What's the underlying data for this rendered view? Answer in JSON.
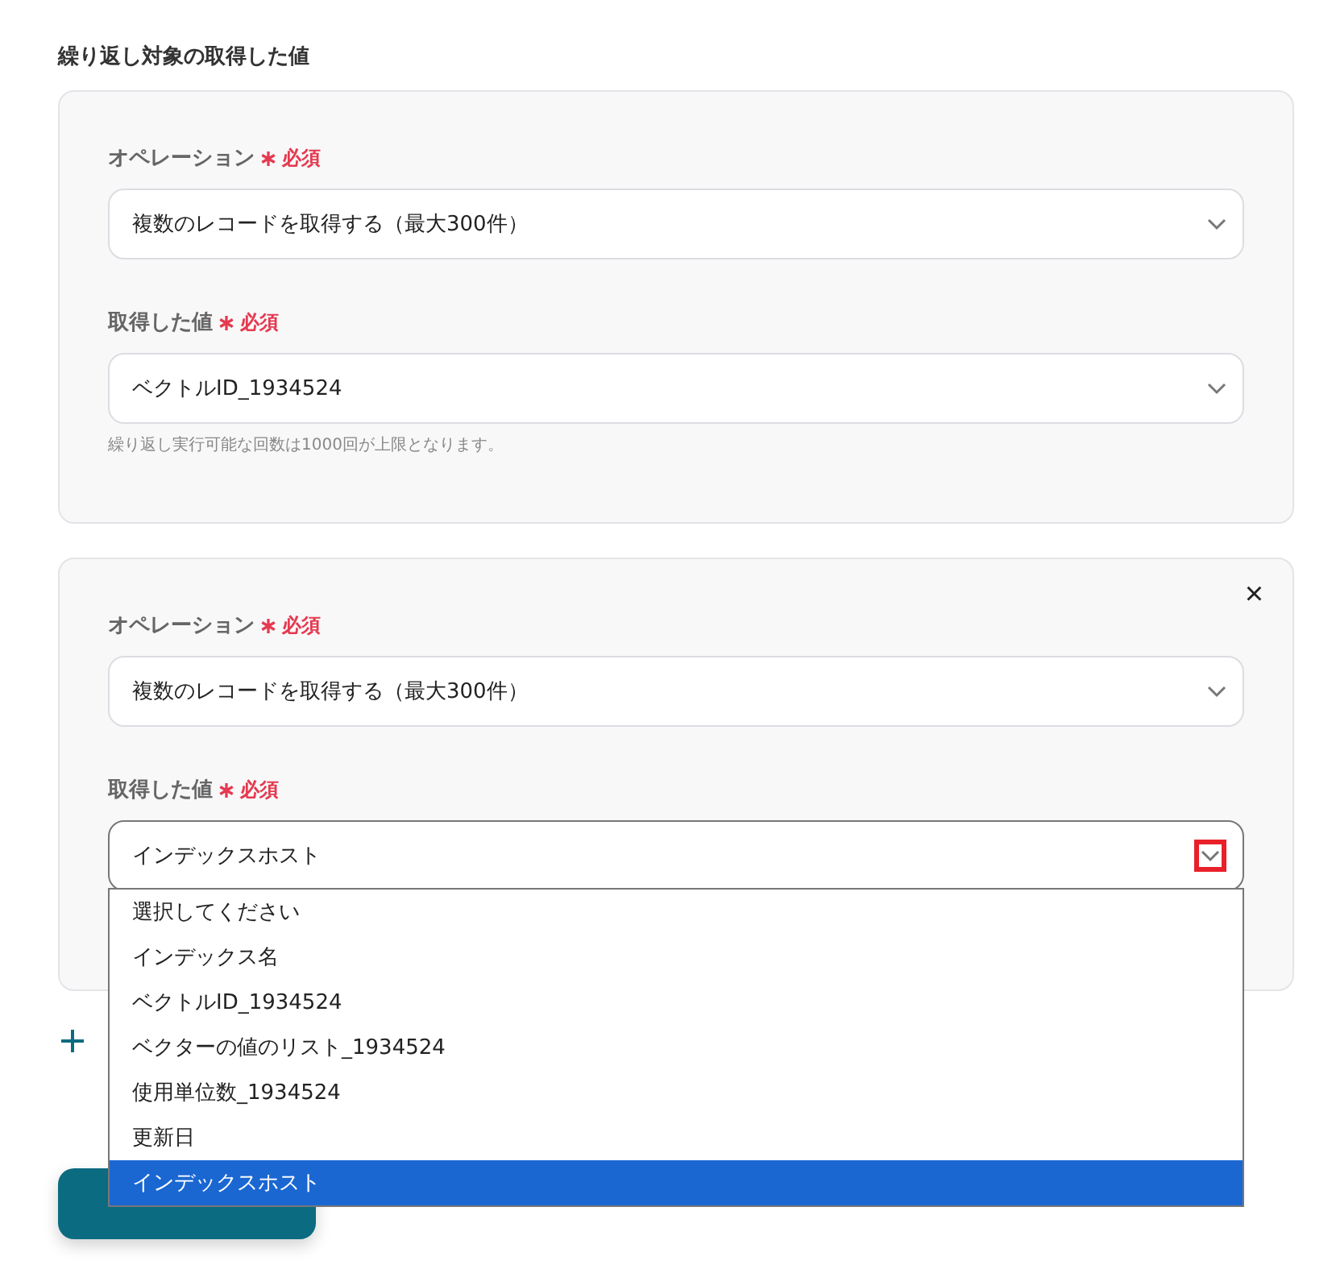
{
  "section_title": "繰り返し対象の取得した値",
  "cards": [
    {
      "fields": [
        {
          "label": "オペレーション",
          "required_mark": "必須",
          "value": "複数のレコードを取得する（最大300件）",
          "focused": false
        },
        {
          "label": "取得した値",
          "required_mark": "必須",
          "value": "ベクトルID_1934524",
          "focused": false,
          "help": "繰り返し実行可能な回数は1000回が上限となります。"
        }
      ]
    },
    {
      "close_icon": "×",
      "fields": [
        {
          "label": "オペレーション",
          "required_mark": "必須",
          "value": "複数のレコードを取得する（最大300件）",
          "focused": false
        },
        {
          "label": "取得した値",
          "required_mark": "必須",
          "value": "インデックスホスト",
          "focused": true,
          "chevron_highlighted": true,
          "options": [
            {
              "label": "選択してください",
              "selected": false
            },
            {
              "label": "インデックス名",
              "selected": false
            },
            {
              "label": "ベクトルID_1934524",
              "selected": false
            },
            {
              "label": "ベクターの値のリスト_1934524",
              "selected": false
            },
            {
              "label": "使用単位数_1934524",
              "selected": false
            },
            {
              "label": "更新日",
              "selected": false
            },
            {
              "label": "インデックスホスト",
              "selected": true
            }
          ]
        }
      ]
    }
  ]
}
